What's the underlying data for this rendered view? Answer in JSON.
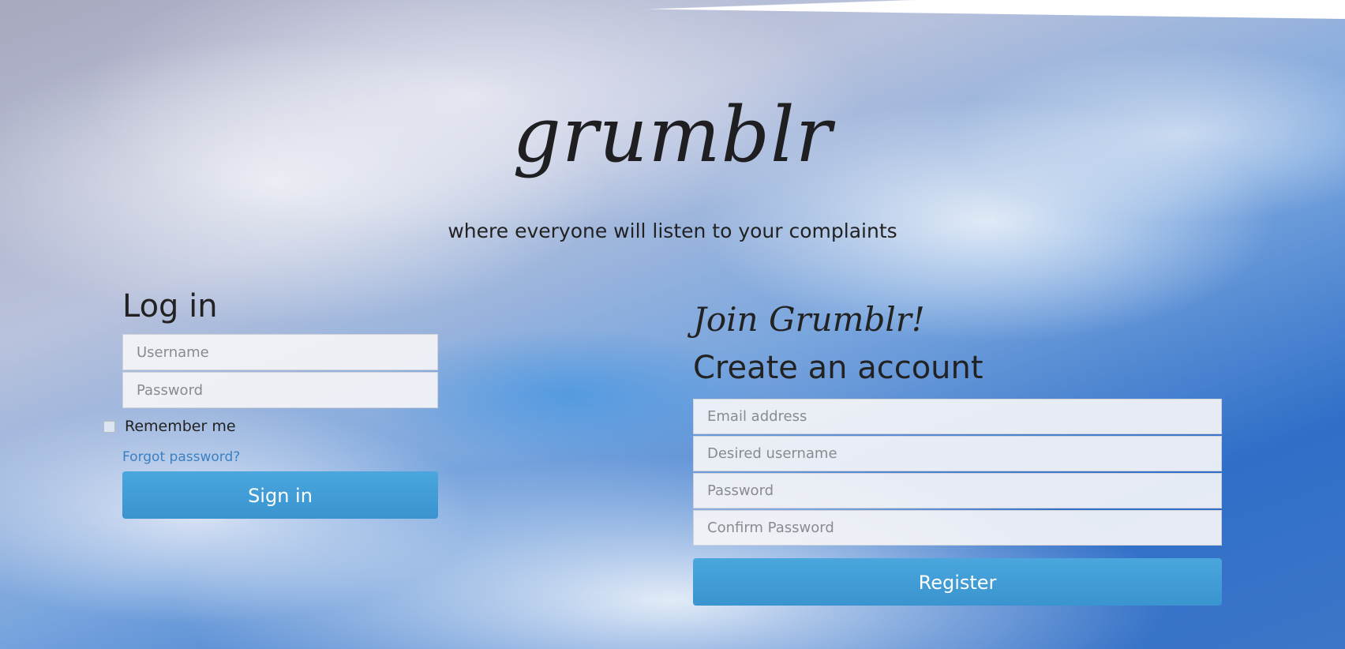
{
  "brand": {
    "logo": "grumblr",
    "tagline": "where everyone will listen to your complaints"
  },
  "login": {
    "heading": "Log in",
    "username_placeholder": "Username",
    "password_placeholder": "Password",
    "remember_label": "Remember me",
    "forgot_link": "Forgot password?",
    "submit_label": "Sign in"
  },
  "register": {
    "join_heading": "Join Grumblr!",
    "create_heading": "Create an account",
    "email_placeholder": "Email address",
    "username_placeholder": "Desired username",
    "password_placeholder": "Password",
    "confirm_placeholder": "Confirm Password",
    "submit_label": "Register"
  },
  "colors": {
    "accent": "#3d9ad6",
    "link": "#3b7fc2",
    "text": "#222222"
  }
}
